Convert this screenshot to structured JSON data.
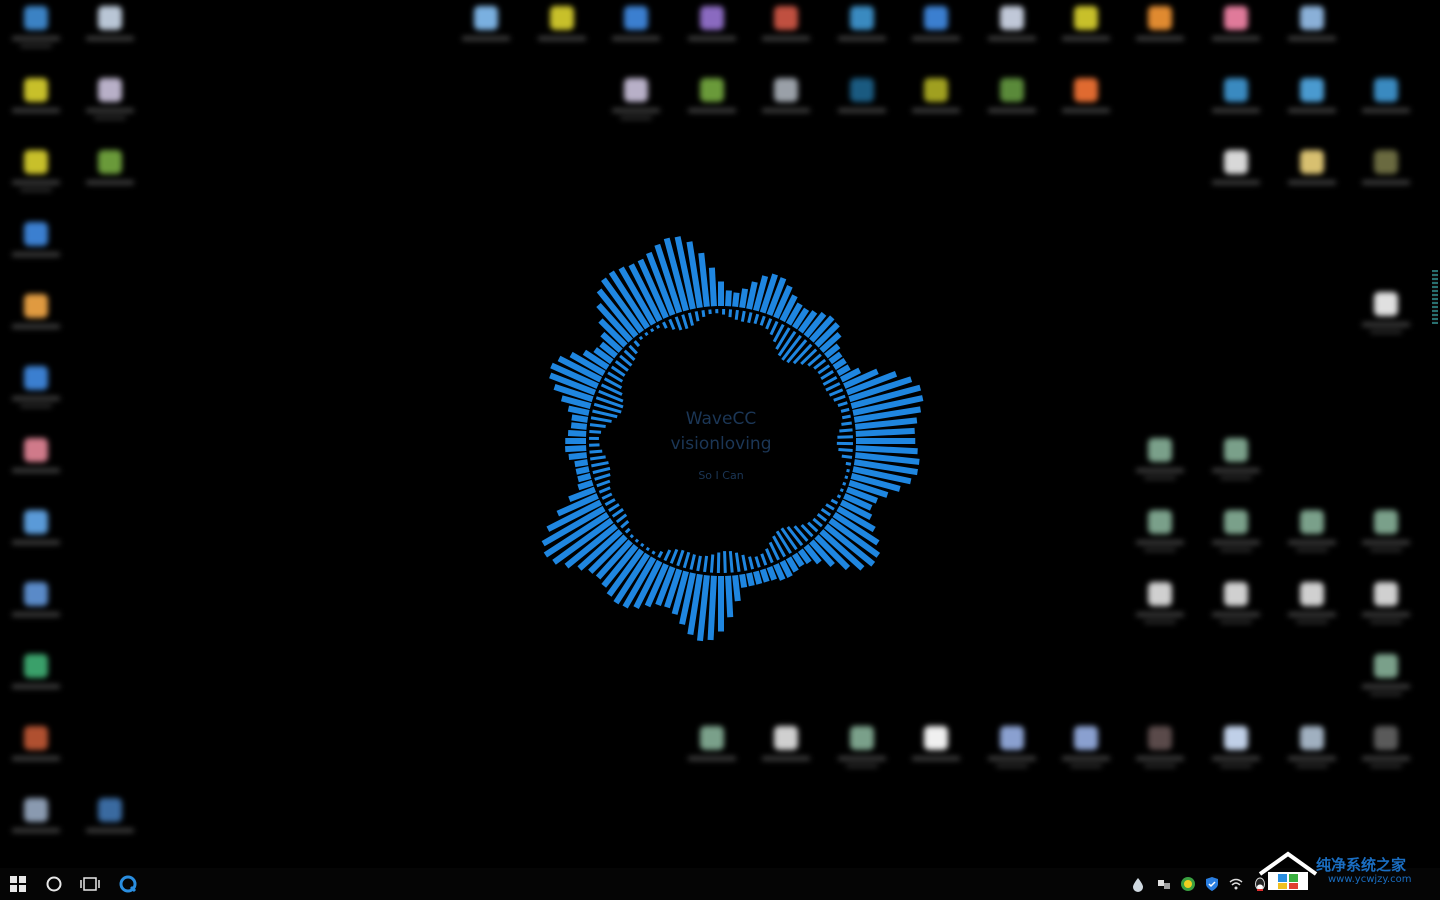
{
  "visualizer": {
    "title": "WaveCC",
    "subtitle": "visionloving",
    "tagline": "So  I Can",
    "accent": "#1f86e0"
  },
  "desktop_icons": [
    {
      "name": "desktop-icon-1",
      "color": "#3b82c4"
    },
    {
      "name": "desktop-icon-2",
      "color": "#b9c6d6"
    },
    {
      "name": "desktop-icon-3",
      "color": "#c8c02a"
    },
    {
      "name": "desktop-icon-4",
      "color": "#b8b0c8"
    },
    {
      "name": "desktop-icon-5",
      "color": "#c8c02a"
    },
    {
      "name": "desktop-icon-6",
      "color": "#6a9a3a"
    },
    {
      "name": "desktop-icon-7",
      "color": "#3b7fd0"
    },
    {
      "name": "desktop-icon-8",
      "color": "#e09a40"
    },
    {
      "name": "desktop-icon-9",
      "color": "#3b7fd0"
    },
    {
      "name": "desktop-icon-10",
      "color": "#d07a8a"
    },
    {
      "name": "desktop-icon-11",
      "color": "#5a9ad8"
    },
    {
      "name": "desktop-icon-12",
      "color": "#5a8ac8"
    },
    {
      "name": "desktop-icon-13",
      "color": "#3aa06a"
    },
    {
      "name": "desktop-icon-14",
      "color": "#b05030"
    },
    {
      "name": "desktop-icon-15",
      "color": "#8a9ab0"
    },
    {
      "name": "desktop-icon-16",
      "color": "#3a6aa0"
    }
  ],
  "taskbar": {
    "start_icon": "windows-logo-icon",
    "search_icon": "cortana-circle-icon",
    "taskview_icon": "task-view-icon",
    "pinned_app_icon": "browser-icon"
  },
  "watermark": {
    "title": "纯净系统之家",
    "url": "www.ycwjzy.com"
  }
}
